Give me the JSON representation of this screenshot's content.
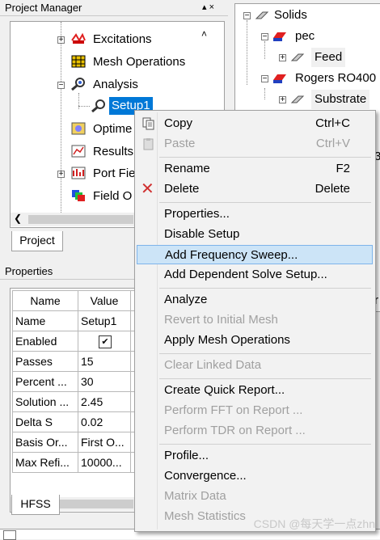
{
  "project_manager": {
    "title": "Project Manager",
    "controls": "▴ ×",
    "tree": [
      {
        "label": "Excitations"
      },
      {
        "label": "Mesh Operations"
      },
      {
        "label": "Analysis"
      },
      {
        "label": "Setup1"
      },
      {
        "label": "Optime"
      },
      {
        "label": "Results"
      },
      {
        "label": "Port Fie"
      },
      {
        "label": "Field O"
      }
    ],
    "tab": "Project"
  },
  "modeler_tree": {
    "items": [
      {
        "label": "Solids"
      },
      {
        "label": "pec"
      },
      {
        "label": "Feed"
      },
      {
        "label": "Rogers RO400"
      },
      {
        "label": "Substrate"
      }
    ],
    "clipped_char": "3",
    "clipped_char2": "r"
  },
  "properties": {
    "title": "Properties",
    "headers": [
      "Name",
      "Value"
    ],
    "rows": [
      {
        "name": "Name",
        "value": "Setup1"
      },
      {
        "name": "Enabled",
        "value": "✔"
      },
      {
        "name": "Passes",
        "value": "15"
      },
      {
        "name": "Percent ...",
        "value": "30"
      },
      {
        "name": "Solution ...",
        "value": "2.45"
      },
      {
        "name": "Delta S",
        "value": "0.02"
      },
      {
        "name": "Basis Or...",
        "value": "First O..."
      },
      {
        "name": "Max Refi...",
        "value": "10000..."
      }
    ],
    "tab": "HFSS"
  },
  "context_menu": {
    "items": [
      {
        "label": "Copy",
        "shortcut": "Ctrl+C"
      },
      {
        "label": "Paste",
        "shortcut": "Ctrl+V"
      },
      {
        "label": "Rename",
        "shortcut": "F2"
      },
      {
        "label": "Delete",
        "shortcut": "Delete"
      },
      {
        "label": "Properties..."
      },
      {
        "label": "Disable Setup"
      },
      {
        "label": "Add Frequency Sweep..."
      },
      {
        "label": "Add Dependent Solve Setup..."
      },
      {
        "label": "Analyze"
      },
      {
        "label": "Revert to Initial Mesh"
      },
      {
        "label": "Apply Mesh Operations"
      },
      {
        "label": "Clear Linked Data"
      },
      {
        "label": "Create Quick Report..."
      },
      {
        "label": "Perform FFT on Report ..."
      },
      {
        "label": "Perform TDR on Report ..."
      },
      {
        "label": "Profile..."
      },
      {
        "label": "Convergence..."
      },
      {
        "label": "Matrix Data"
      },
      {
        "label": "Mesh Statistics"
      }
    ]
  },
  "watermark": "CSDN @每天学一点zhn",
  "colors": {
    "highlight": "#cce4f7",
    "highlight_border": "#7eb4ea",
    "selected": "#0078d7"
  }
}
